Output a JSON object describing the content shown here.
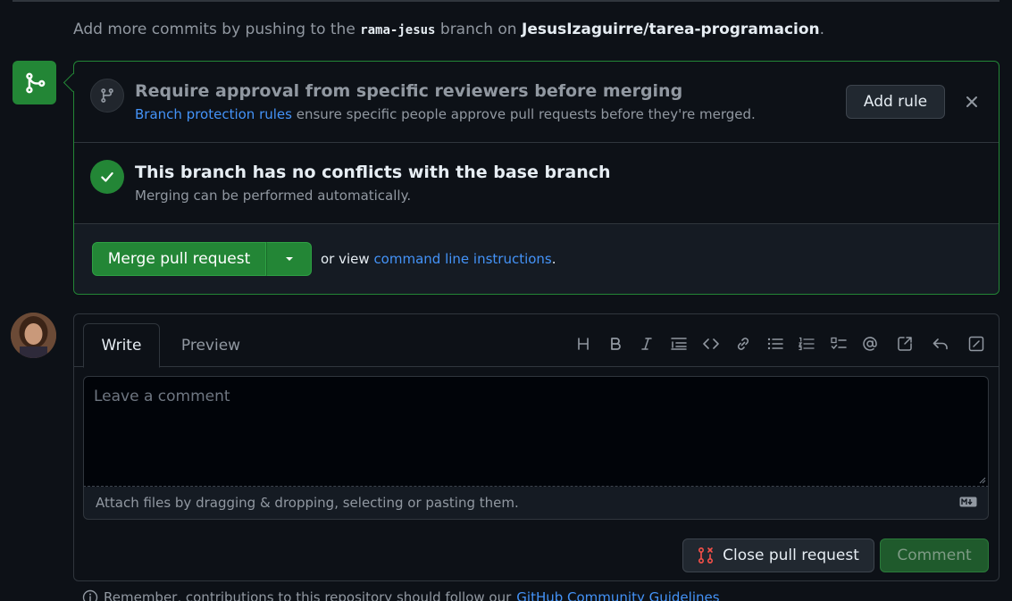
{
  "push_message": {
    "prefix": "Add more commits by pushing to the",
    "branch": "rama-jesus",
    "middle": "branch on",
    "repo": "JesusIzaguirre/tarea-programacion",
    "suffix": "."
  },
  "merge_box": {
    "reviewers": {
      "title": "Require approval from specific reviewers before merging",
      "link": "Branch protection rules",
      "text": "ensure specific people approve pull requests before they're merged.",
      "add_rule": "Add rule"
    },
    "conflicts": {
      "title": "This branch has no conflicts with the base branch",
      "subtitle": "Merging can be performed automatically."
    },
    "merge": {
      "button": "Merge pull request",
      "or_view": "or view",
      "link": "command line instructions",
      "period": "."
    }
  },
  "comment": {
    "tabs": {
      "write": "Write",
      "preview": "Preview"
    },
    "placeholder": "Leave a comment",
    "attach": "Attach files by dragging & dropping, selecting or pasting them.",
    "close_pr": "Close pull request",
    "comment_btn": "Comment"
  },
  "footer": {
    "text": "Remember, contributions to this repository should follow our",
    "link": "GitHub Community Guidelines"
  },
  "colors": {
    "accent_green": "#238636",
    "link": "#4493f8",
    "bg": "#0d1117"
  }
}
